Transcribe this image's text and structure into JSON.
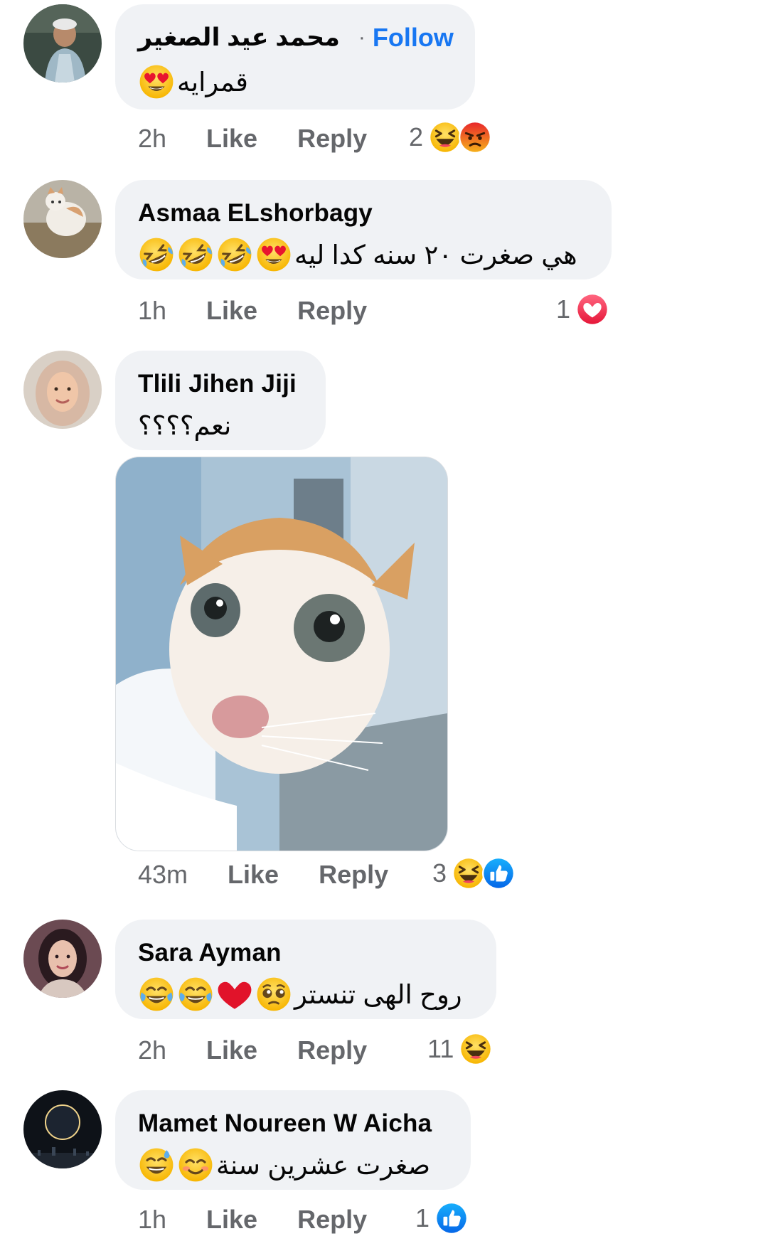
{
  "comments": [
    {
      "author": "محمد عيد الصغير",
      "verified": true,
      "follow_label": "Follow",
      "separator": "·",
      "text": "قمرايه",
      "text_emojis": [
        "heart-eyes-emoji"
      ],
      "time": "2h",
      "like_label": "Like",
      "reply_label": "Reply",
      "reaction_count": "2",
      "reactions": [
        "haha-reaction",
        "angry-reaction"
      ]
    },
    {
      "author": "Asmaa ELshorbagy",
      "text": "هي صغرت ٢٠ سنه كدا ليه",
      "text_emojis": [
        "rofl-emoji",
        "rofl-emoji",
        "rofl-emoji",
        "heart-eyes-emoji"
      ],
      "time": "1h",
      "like_label": "Like",
      "reply_label": "Reply",
      "reaction_count": "1",
      "reactions": [
        "love-reaction"
      ]
    },
    {
      "author": "Tlili Jihen Jiji",
      "text": "نعم؟؟؟؟",
      "attachment": "cat-photo",
      "time": "43m",
      "like_label": "Like",
      "reply_label": "Reply",
      "reaction_count": "3",
      "reactions": [
        "haha-reaction",
        "like-reaction"
      ]
    },
    {
      "author": "Sara Ayman",
      "text": "روح الهى تنستر",
      "text_emojis": [
        "joy-emoji",
        "joy-emoji",
        "red-heart-emoji",
        "pleading-emoji"
      ],
      "time": "2h",
      "like_label": "Like",
      "reply_label": "Reply",
      "reaction_count": "11",
      "reactions": [
        "haha-reaction"
      ]
    },
    {
      "author": "Mamet Noureen W Aicha",
      "text": "صغرت عشرين سنة",
      "text_emojis": [
        "sweat-smile-emoji",
        "blush-emoji"
      ],
      "time": "1h",
      "like_label": "Like",
      "reply_label": "Reply",
      "reaction_count": "1",
      "reactions": [
        "like-reaction"
      ]
    }
  ],
  "colors": {
    "bubble": "#f0f2f5",
    "follow": "#1877f2",
    "meta": "#65676b",
    "text": "#050505",
    "love": "#f33e58",
    "emoji_yellow": "#ffcc4d",
    "angry": "#e9710f"
  }
}
